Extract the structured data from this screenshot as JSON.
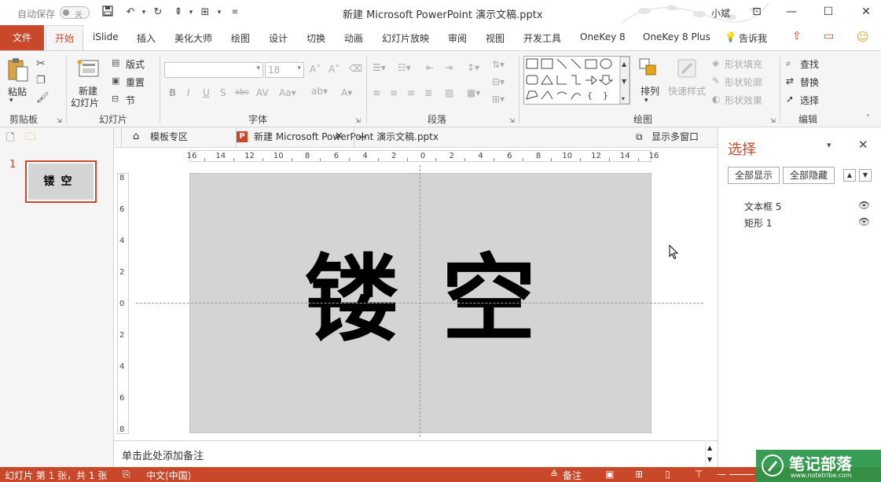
{
  "titlebar": {
    "autosave_label": "自动保存",
    "autosave_state": "关",
    "document_title": "新建 Microsoft PowerPoint 演示文稿.pptx",
    "user": "小斌"
  },
  "tabs": {
    "file": "文件",
    "home": "开始",
    "items": [
      "iSlide",
      "插入",
      "美化大师",
      "绘图",
      "设计",
      "切换",
      "动画",
      "幻灯片放映",
      "审阅",
      "视图",
      "开发工具",
      "OneKey 8",
      "OneKey 8 Plus"
    ],
    "tell_me": "告诉我"
  },
  "ribbon": {
    "clipboard": {
      "paste": "粘贴",
      "label": "剪贴板"
    },
    "slides": {
      "new_slide_line1": "新建",
      "new_slide_line2": "幻灯片",
      "layout": "版式",
      "reset": "重置",
      "section": "节",
      "label": "幻灯片"
    },
    "font": {
      "size": "18",
      "label": "字体"
    },
    "paragraph": {
      "label": "段落"
    },
    "drawing": {
      "arrange": "排列",
      "quick_styles": "快速样式",
      "fill": "形状填充",
      "outline": "形状轮廓",
      "effect": "形状效果",
      "label": "绘图"
    },
    "editing": {
      "find": "查找",
      "replace": "替换",
      "select": "选择",
      "label": "编辑"
    }
  },
  "doc_tabs": {
    "template": "模板专区",
    "current": "新建 Microsoft PowerPoint 演示文稿.pptx",
    "multi_window": "显示多窗口"
  },
  "thumbnails": [
    {
      "number": "1",
      "text": "镂空"
    }
  ],
  "slide": {
    "char1": "镂",
    "char2": "空",
    "background": "#d4d4d4"
  },
  "ruler": {
    "h_labels": [
      "16",
      "14",
      "12",
      "10",
      "8",
      "6",
      "4",
      "2",
      "0",
      "2",
      "4",
      "6",
      "8",
      "10",
      "12",
      "14",
      "16"
    ],
    "v_labels": [
      "8",
      "6",
      "4",
      "2",
      "0",
      "2",
      "4",
      "6",
      "8"
    ]
  },
  "notes": {
    "placeholder": "单击此处添加备注"
  },
  "selection_pane": {
    "title": "选择",
    "show_all": "全部显示",
    "hide_all": "全部隐藏",
    "items": [
      "文本框 5",
      "矩形 1"
    ]
  },
  "statusbar": {
    "slide_info": "幻灯片 第 1 张，共 1 张",
    "language": "中文(中国)",
    "notes": "备注"
  },
  "watermark": {
    "title": "笔记部落",
    "url": "www.notetribe.com"
  },
  "colors": {
    "accent": "#c9482a",
    "ribbon_bg": "#f5f5f5"
  }
}
